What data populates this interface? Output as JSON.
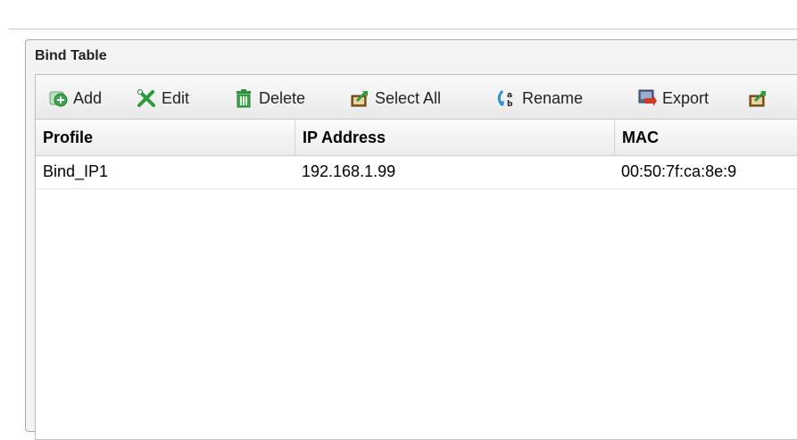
{
  "panel": {
    "title": "Bind Table"
  },
  "toolbar": {
    "add_label": "Add",
    "edit_label": "Edit",
    "delete_label": "Delete",
    "select_all_label": "Select All",
    "rename_label": "Rename",
    "export_label": "Export"
  },
  "table": {
    "columns": [
      "Profile",
      "IP Address",
      "MAC"
    ],
    "rows": [
      [
        "Bind_IP1",
        "192.168.1.99",
        "00:50:7f:ca:8e:9"
      ]
    ]
  },
  "icons": {
    "add": "add-icon",
    "edit": "edit-icon",
    "delete": "trash-icon",
    "select_all": "select-all-icon",
    "rename": "rename-icon",
    "export": "export-icon",
    "import": "import-icon"
  },
  "colors": {
    "add_green": "#3aa84a",
    "edit_green": "#2a9a3a",
    "trash_green": "#2e8f3a",
    "export_red": "#d03a2a",
    "select_orange": "#e0a020"
  }
}
